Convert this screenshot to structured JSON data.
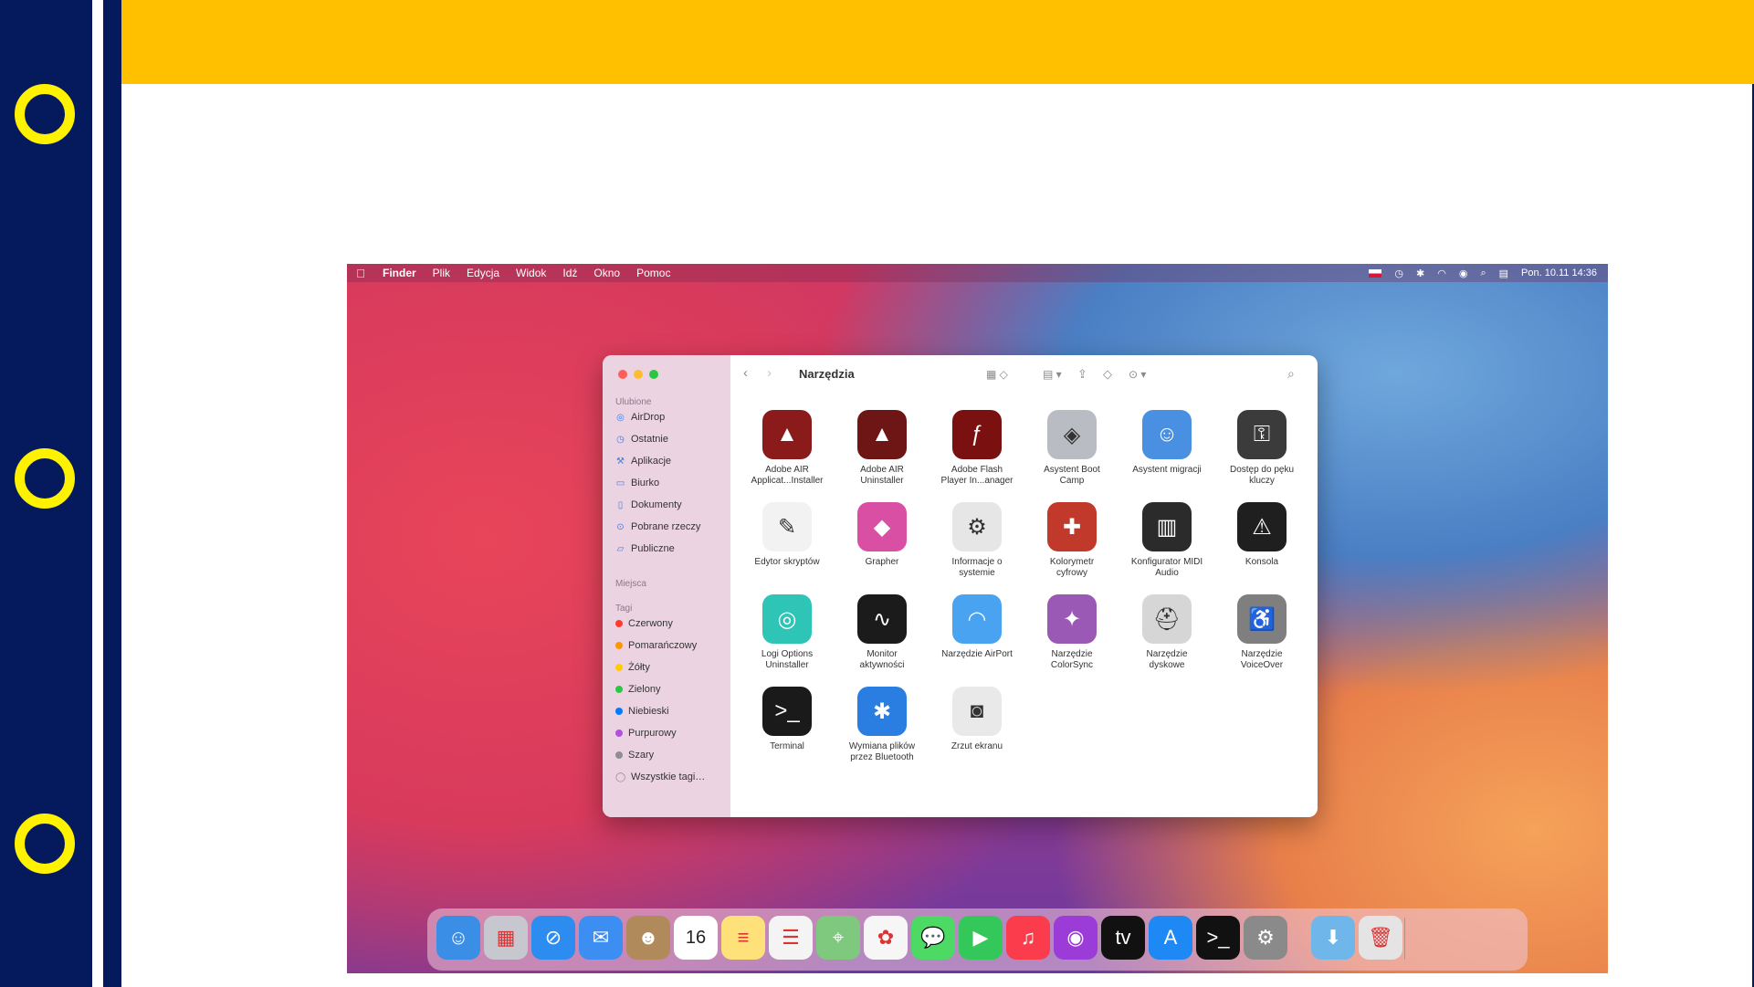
{
  "menubar": {
    "apple": "",
    "items": [
      "Finder",
      "Plik",
      "Edycja",
      "Widok",
      "Idź",
      "Okno",
      "Pomoc"
    ],
    "clock": "Pon. 10.11  14:36"
  },
  "finder": {
    "title": "Narzędzia",
    "sidebar": {
      "favorites_title": "Ulubione",
      "favorites": [
        "AirDrop",
        "Ostatnie",
        "Aplikacje",
        "Biurko",
        "Dokumenty",
        "Pobrane rzeczy",
        "Publiczne"
      ],
      "places_title": "Miejsca",
      "tags_title": "Tagi",
      "tags": [
        {
          "label": "Czerwony",
          "color": "#ff3b30"
        },
        {
          "label": "Pomarańczowy",
          "color": "#ff9500"
        },
        {
          "label": "Żółty",
          "color": "#ffcc00"
        },
        {
          "label": "Zielony",
          "color": "#28c840"
        },
        {
          "label": "Niebieski",
          "color": "#007aff"
        },
        {
          "label": "Purpurowy",
          "color": "#af52de"
        },
        {
          "label": "Szary",
          "color": "#8e8e93"
        },
        {
          "label": "Wszystkie tagi…",
          "color": ""
        }
      ]
    },
    "apps": [
      {
        "line1": "Adobe AIR",
        "line2": "Applicat...Installer",
        "icon": "adobe-air-icon",
        "color": "#8b1a1a",
        "glyph": "▲"
      },
      {
        "line1": "Adobe AIR",
        "line2": "Uninstaller",
        "icon": "adobe-air-uninstaller-icon",
        "color": "#6e1515",
        "glyph": "▲"
      },
      {
        "line1": "Adobe Flash",
        "line2": "Player In...anager",
        "icon": "flash-icon",
        "color": "#7a1010",
        "glyph": "ƒ"
      },
      {
        "line1": "Asystent Boot",
        "line2": "Camp",
        "icon": "boot-camp-icon",
        "color": "#b9bcc2",
        "glyph": "◈"
      },
      {
        "line1": "Asystent migracji",
        "line2": "",
        "icon": "migration-icon",
        "color": "#4a90e2",
        "glyph": "☺"
      },
      {
        "line1": "Dostęp do pęku",
        "line2": "kluczy",
        "icon": "keychain-icon",
        "color": "#3b3b3b",
        "glyph": "⚿"
      },
      {
        "line1": "Edytor skryptów",
        "line2": "",
        "icon": "script-editor-icon",
        "color": "#f2f2f2",
        "glyph": "✎"
      },
      {
        "line1": "Grapher",
        "line2": "",
        "icon": "grapher-icon",
        "color": "#d94fa3",
        "glyph": "◆"
      },
      {
        "line1": "Informacje o",
        "line2": "systemie",
        "icon": "system-info-icon",
        "color": "#e6e6e6",
        "glyph": "⚙"
      },
      {
        "line1": "Kolorymetr",
        "line2": "cyfrowy",
        "icon": "colorimeter-icon",
        "color": "#c0392b",
        "glyph": "✚"
      },
      {
        "line1": "Konfigurator MIDI",
        "line2": "Audio",
        "icon": "midi-icon",
        "color": "#2b2b2b",
        "glyph": "▥"
      },
      {
        "line1": "Konsola",
        "line2": "",
        "icon": "console-icon",
        "color": "#1f1f1f",
        "glyph": "⚠"
      },
      {
        "line1": "Logi Options",
        "line2": "Uninstaller",
        "icon": "logi-icon",
        "color": "#2ec4b6",
        "glyph": "◎"
      },
      {
        "line1": "Monitor",
        "line2": "aktywności",
        "icon": "activity-monitor-icon",
        "color": "#1b1b1b",
        "glyph": "∿"
      },
      {
        "line1": "Narzędzie AirPort",
        "line2": "",
        "icon": "airport-icon",
        "color": "#4aa3f0",
        "glyph": "◠"
      },
      {
        "line1": "Narzędzie",
        "line2": "ColorSync",
        "icon": "colorsync-icon",
        "color": "#9b59b6",
        "glyph": "✦"
      },
      {
        "line1": "Narzędzie",
        "line2": "dyskowe",
        "icon": "disk-utility-icon",
        "color": "#d6d6d6",
        "glyph": "⛑"
      },
      {
        "line1": "Narzędzie",
        "line2": "VoiceOver",
        "icon": "voiceover-icon",
        "color": "#7f7f7f",
        "glyph": "♿"
      },
      {
        "line1": "Terminal",
        "line2": "",
        "icon": "terminal-icon",
        "color": "#1a1a1a",
        "glyph": ">_"
      },
      {
        "line1": "Wymiana plików",
        "line2": "przez Bluetooth",
        "icon": "bluetooth-icon",
        "color": "#2a7de1",
        "glyph": "✱"
      },
      {
        "line1": "Zrzut ekranu",
        "line2": "",
        "icon": "screenshot-icon",
        "color": "#e9e9e9",
        "glyph": "◙"
      }
    ]
  },
  "dock": [
    {
      "name": "finder-icon",
      "color": "#3a8ee6",
      "glyph": "☺"
    },
    {
      "name": "launchpad-icon",
      "color": "#c7c7cf",
      "glyph": "▦"
    },
    {
      "name": "safari-icon",
      "color": "#2d8cf0",
      "glyph": "⊘"
    },
    {
      "name": "mail-icon",
      "color": "#3c8ef3",
      "glyph": "✉"
    },
    {
      "name": "contacts-icon",
      "color": "#b08a5a",
      "glyph": "☻"
    },
    {
      "name": "calendar-icon",
      "color": "#ffffff",
      "glyph": "16"
    },
    {
      "name": "notes-icon",
      "color": "#ffe17a",
      "glyph": "≡"
    },
    {
      "name": "reminders-icon",
      "color": "#f4f4f4",
      "glyph": "☰"
    },
    {
      "name": "maps-icon",
      "color": "#7fc97f",
      "glyph": "⌖"
    },
    {
      "name": "photos-icon",
      "color": "#f6f6f6",
      "glyph": "✿"
    },
    {
      "name": "messages-icon",
      "color": "#4cd964",
      "glyph": "💬"
    },
    {
      "name": "facetime-icon",
      "color": "#34c759",
      "glyph": "▶"
    },
    {
      "name": "music-icon",
      "color": "#fa3c4c",
      "glyph": "♫"
    },
    {
      "name": "podcasts-icon",
      "color": "#9b3bd8",
      "glyph": "◉"
    },
    {
      "name": "tv-icon",
      "color": "#111111",
      "glyph": "tv"
    },
    {
      "name": "app-store-icon",
      "color": "#1e88f5",
      "glyph": "A"
    },
    {
      "name": "terminal-dock-icon",
      "color": "#111111",
      "glyph": ">_"
    },
    {
      "name": "system-preferences-icon",
      "color": "#8a8a8a",
      "glyph": "⚙"
    },
    {
      "name": "downloads-folder-icon",
      "color": "#6fb7ea",
      "glyph": "⬇"
    },
    {
      "name": "trash-icon",
      "color": "#e4e4e4",
      "glyph": "🗑"
    }
  ],
  "colors": {
    "navy": "#041a5c",
    "yellow_bar": "#ffc000",
    "ring": "#fff200"
  }
}
